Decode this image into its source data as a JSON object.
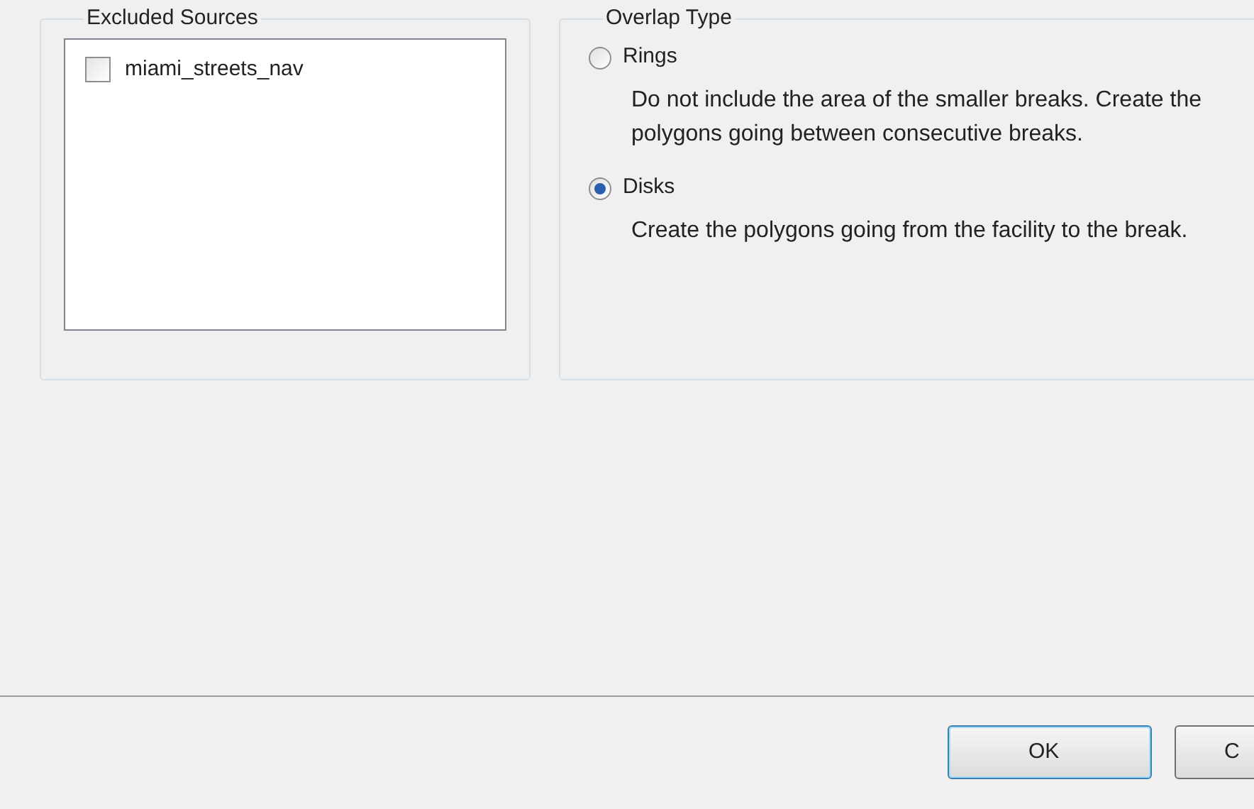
{
  "excluded_sources": {
    "title": "Excluded Sources",
    "items": [
      {
        "label": "miami_streets_nav",
        "checked": false
      }
    ]
  },
  "overlap_type": {
    "title": "Overlap Type",
    "options": [
      {
        "label": "Rings",
        "description": "Do not include the area of the smaller breaks. Create the polygons going between consecutive breaks.",
        "selected": false
      },
      {
        "label": "Disks",
        "description": "Create the polygons going from the facility to the break.",
        "selected": true
      }
    ]
  },
  "buttons": [
    "OK",
    "C"
  ]
}
